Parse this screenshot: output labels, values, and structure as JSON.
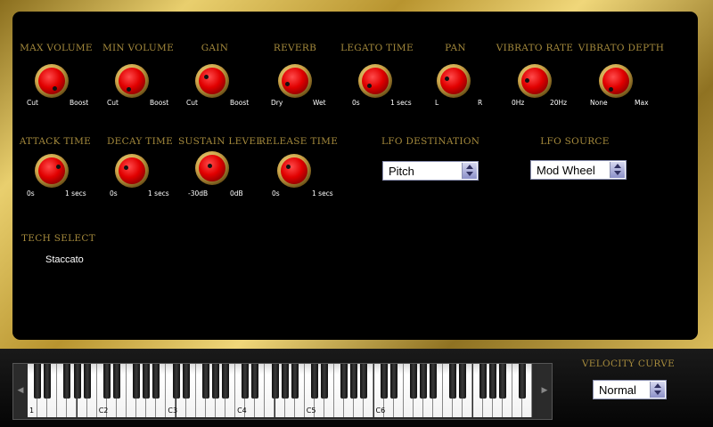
{
  "knobs_row1": [
    {
      "label": "MAX VOLUME",
      "min": "Cut",
      "max": "Boost"
    },
    {
      "label": "MIN VOLUME",
      "min": "Cut",
      "max": "Boost"
    },
    {
      "label": "GAIN",
      "min": "Cut",
      "max": "Boost"
    },
    {
      "label": "REVERB",
      "min": "Dry",
      "max": "Wet"
    },
    {
      "label": "LEGATO TIME",
      "min": "0s",
      "max": "1 secs"
    },
    {
      "label": "PAN",
      "min": "L",
      "max": "R"
    },
    {
      "label": "VIBRATO RATE",
      "min": "0Hz",
      "max": "20Hz"
    },
    {
      "label": "VIBRATO DEPTH",
      "min": "None",
      "max": "Max"
    }
  ],
  "knobs_row2": [
    {
      "label": "ATTACK TIME",
      "min": "0s",
      "max": "1 secs"
    },
    {
      "label": "DECAY TIME",
      "min": "0s",
      "max": "1 secs"
    },
    {
      "label": "SUSTAIN LEVEL",
      "min": "-30dB",
      "max": "0dB"
    },
    {
      "label": "RELEASE TIME",
      "min": "0s",
      "max": "1 secs"
    }
  ],
  "lfo_destination": {
    "label": "LFO DESTINATION",
    "value": "Pitch"
  },
  "lfo_source": {
    "label": "LFO SOURCE",
    "value": "Mod Wheel"
  },
  "tech_select": {
    "label": "TECH SELECT",
    "value": "Staccato"
  },
  "velocity_curve": {
    "label": "VELOCITY CURVE",
    "value": "Normal"
  },
  "keyboard": {
    "notes": [
      "1",
      "C2",
      "C3",
      "C4",
      "C5",
      "C6"
    ],
    "left_arrow": "◀",
    "right_arrow": "▶"
  },
  "colors": {
    "label_gold": "#a58a3c",
    "knob_red": "#e10000",
    "frame_gold": "#e9cf6e"
  }
}
